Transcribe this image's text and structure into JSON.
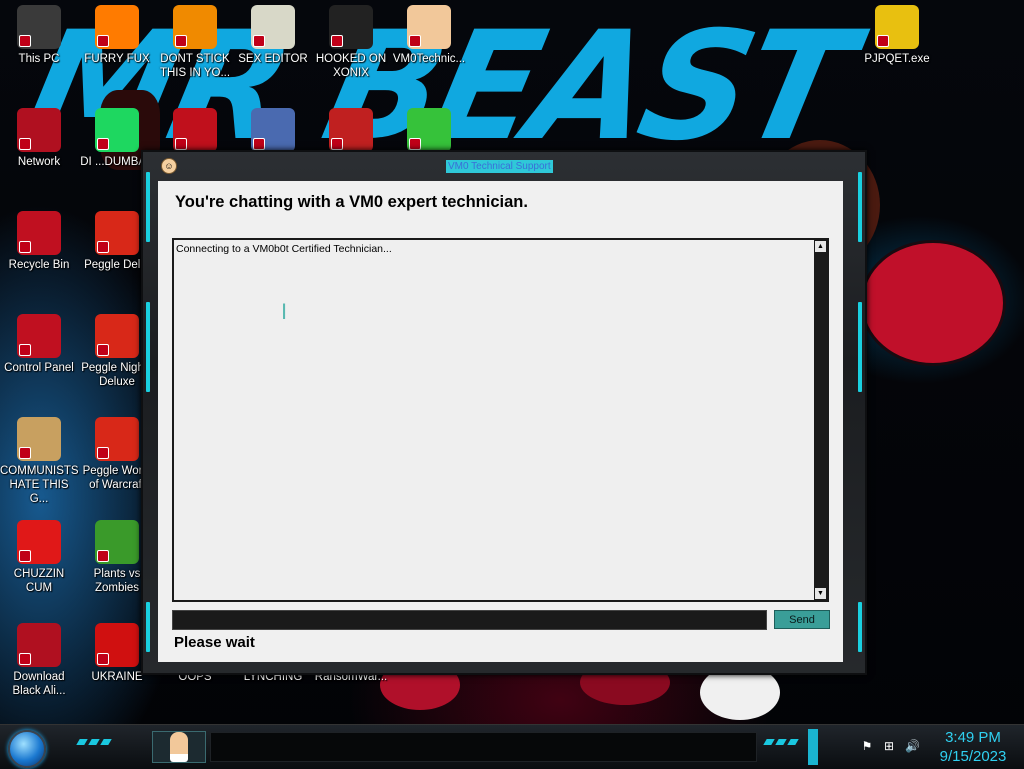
{
  "desktop": {
    "icons": [
      {
        "label": "This PC",
        "icon": "computer-icon",
        "color": "#3a3a3a"
      },
      {
        "label": "FURRY FUX",
        "icon": "firefox-icon",
        "color": "#ff7b00"
      },
      {
        "label": "DONT STICK THIS IN YO...",
        "icon": "vlc-cone-icon",
        "color": "#f08a00"
      },
      {
        "label": "SEX EDITOR",
        "icon": "hxd-editor-icon",
        "color": "#d8d8c8"
      },
      {
        "label": "HOOKED ON XONIX",
        "icon": "xonix-game-icon",
        "color": "#222222"
      },
      {
        "label": "VM0Technic...",
        "icon": "technician-icon",
        "color": "#f2c89a"
      },
      {
        "label": "PJPQET.exe",
        "icon": "padlock-icon",
        "color": "#e8c010"
      },
      {
        "label": "Network",
        "icon": "network-orb-icon",
        "color": "#b01020"
      },
      {
        "label": "DI ...DUMBAS",
        "icon": "spotify-icon",
        "color": "#1ed760"
      },
      {
        "label": "",
        "icon": "dev-cpp-icon",
        "color": "#c0101c"
      },
      {
        "label": "",
        "icon": "monitor-app-icon",
        "color": "#4a6ab0"
      },
      {
        "label": "",
        "icon": "snowman-icon",
        "color": "#c02020"
      },
      {
        "label": "",
        "icon": "limewire-icon",
        "color": "#36c23a"
      },
      {
        "label": "Recycle Bin",
        "icon": "recycle-bin-icon",
        "color": "#c01020"
      },
      {
        "label": "Peggle Del...",
        "icon": "peggle-icon",
        "color": "#d82818"
      },
      {
        "label": "Control Panel",
        "icon": "control-panel-icon",
        "color": "#c01020"
      },
      {
        "label": "Peggle Nights Deluxe",
        "icon": "peggle-nights-icon",
        "color": "#d82818"
      },
      {
        "label": "COMMUNISTS HATE THIS G...",
        "icon": "money-bag-icon",
        "color": "#c8a060"
      },
      {
        "label": "Peggle World of Warcraft",
        "icon": "peggle-wow-icon",
        "color": "#d82818"
      },
      {
        "label": "CHUZZIN CUM",
        "icon": "chuzzle-icon",
        "color": "#e01818"
      },
      {
        "label": "Plants vs Zombies",
        "icon": "plants-vs-zombies-icon",
        "color": "#3a9a2a"
      },
      {
        "label": "Download Black Ali...",
        "icon": "download-orb-icon",
        "color": "#b01020"
      },
      {
        "label": "UKRAINE",
        "icon": "radiation-icon",
        "color": "#d01010"
      },
      {
        "label": "OOPS",
        "icon": "blank-icon",
        "color": "#000000"
      },
      {
        "label": "LYNCHING",
        "icon": "blank-icon",
        "color": "#000000"
      },
      {
        "label": "RansomWar...",
        "icon": "blank-icon",
        "color": "#000000"
      }
    ],
    "wallpaper_text": "MR BEAST"
  },
  "window": {
    "title": "VM0 Technical Support",
    "heading": "You're chatting with a VM0 expert technician.",
    "chat_log": "Connecting to a VM0b0t Certified Technician...",
    "message_input_value": "",
    "send_label": "Send",
    "status": "Please wait"
  },
  "taskbar": {
    "time": "3:49 PM",
    "date": "9/15/2023",
    "accent": "#2fd0f0"
  }
}
